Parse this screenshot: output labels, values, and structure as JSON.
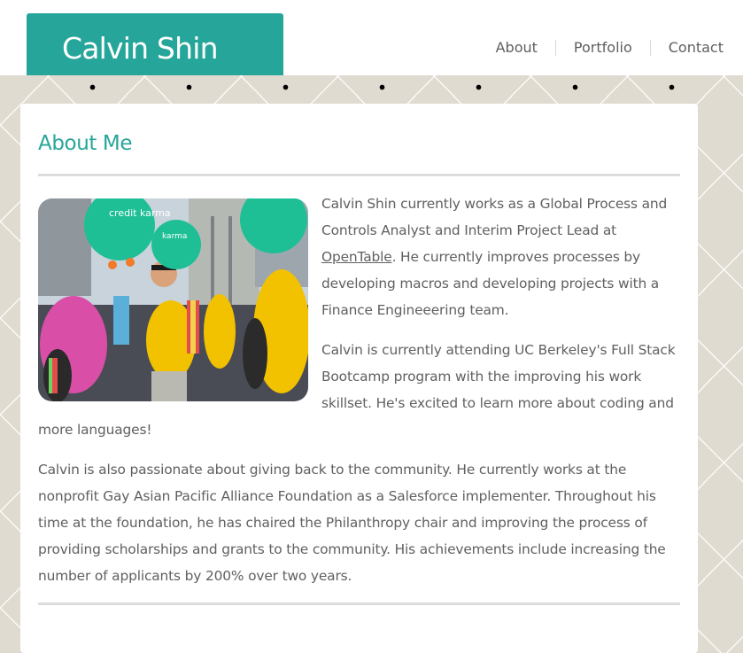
{
  "header": {
    "brand": "Calvin Shin",
    "nav": [
      "About",
      "Portfolio",
      "Contact"
    ]
  },
  "about": {
    "title": "About Me",
    "photo": {
      "balloon_text_1": "credit karma",
      "balloon_text_2": "karma"
    },
    "para1_before": "Calvin Shin currently works as a Global Process and Controls Analyst and Interim Project Lead at ",
    "para1_link": "OpenTable",
    "para1_after": ". He currently improves processes by developing macros and developing projects with a Finance Engineeering team.",
    "para2": "Calvin is currently attending UC Berkeley's Full Stack Bootcamp program with the improving his work skillset. He's excited to learn more about coding and more languages!",
    "para3": "Calvin is also passionate about giving back to the community. He currently works at the nonprofit Gay Asian Pacific Alliance Foundation as a Salesforce implementer. Throughout his time at the foundation, he has chaired the Philanthropy chair and improving the process of providing scholarships and grants to the community. His achievements include increasing the number of applicants by 200% over two years."
  },
  "colors": {
    "accent": "#26a69a",
    "text": "#606060",
    "background": "#e0dbd0"
  }
}
